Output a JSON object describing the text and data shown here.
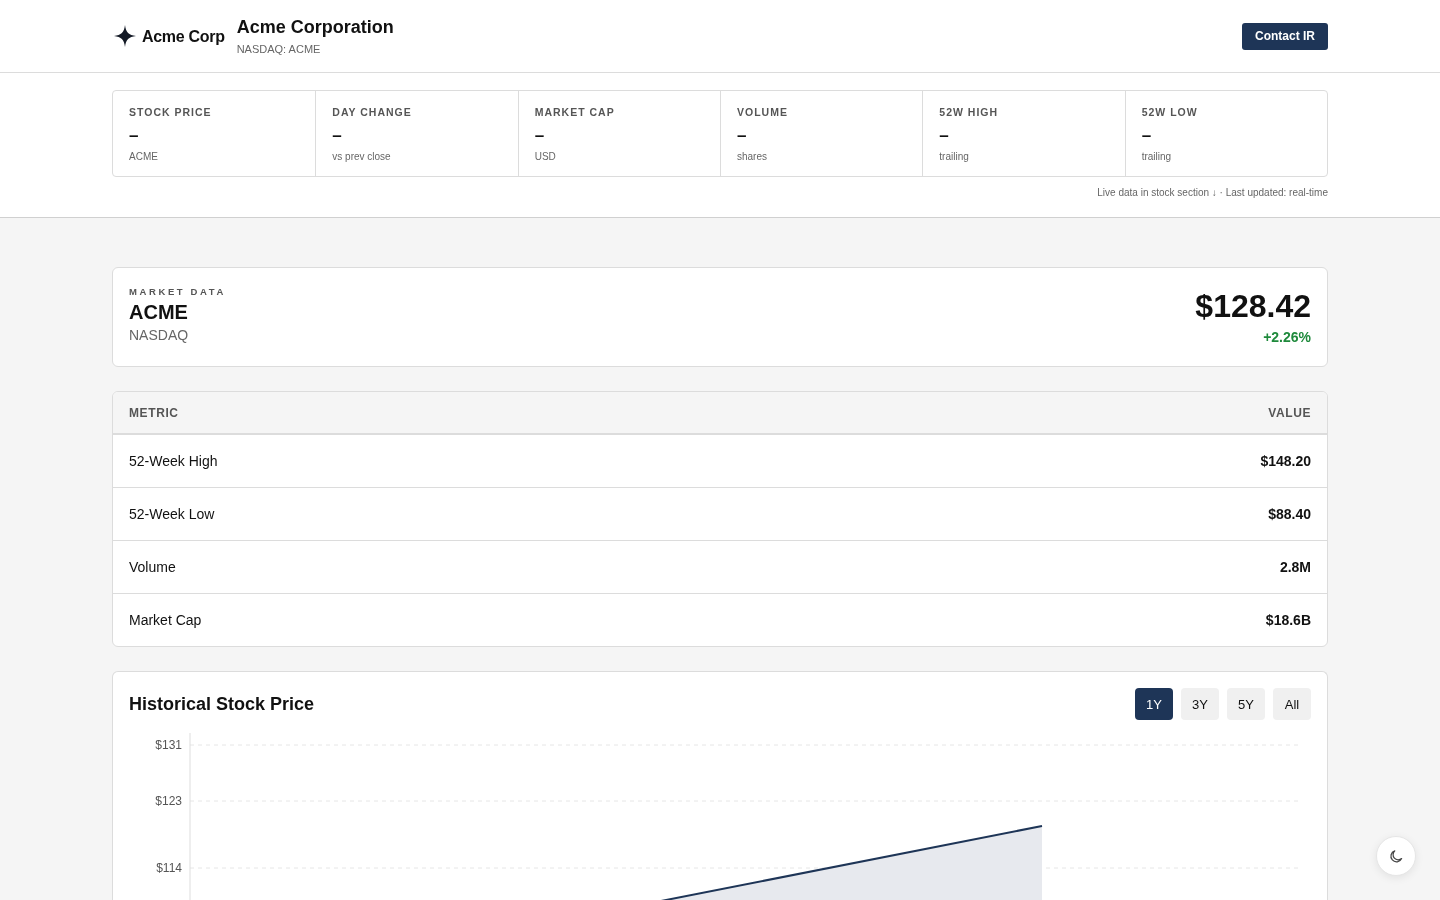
{
  "header": {
    "logo_text": "Acme Corp",
    "title": "Acme Corporation",
    "subtitle": "NASDAQ: ACME",
    "contact_button": "Contact IR"
  },
  "stats": [
    {
      "label": "STOCK PRICE",
      "value": "–",
      "caption": "ACME"
    },
    {
      "label": "DAY CHANGE",
      "value": "–",
      "caption": "vs prev close"
    },
    {
      "label": "MARKET CAP",
      "value": "–",
      "caption": "USD"
    },
    {
      "label": "VOLUME",
      "value": "–",
      "caption": "shares"
    },
    {
      "label": "52W HIGH",
      "value": "–",
      "caption": "trailing"
    },
    {
      "label": "52W LOW",
      "value": "–",
      "caption": "trailing"
    }
  ],
  "stats_note": "Live data in stock section ↓ · Last updated: real-time",
  "market": {
    "eyebrow": "MARKET DATA",
    "symbol": "ACME",
    "exchange": "NASDAQ",
    "price": "$128.42",
    "change": "+2.26%",
    "rising": true
  },
  "metrics_table": {
    "columns": [
      "METRIC",
      "VALUE"
    ],
    "rows": [
      {
        "metric": "52-Week High",
        "value": "$148.20"
      },
      {
        "metric": "52-Week Low",
        "value": "$88.40"
      },
      {
        "metric": "Volume",
        "value": "2.8M"
      },
      {
        "metric": "Market Cap",
        "value": "$18.6B"
      }
    ]
  },
  "chart": {
    "title": "Historical Stock Price",
    "ranges": [
      {
        "label": "1Y",
        "selected": true
      },
      {
        "label": "3Y",
        "selected": false
      },
      {
        "label": "5Y",
        "selected": false
      },
      {
        "label": "All",
        "selected": false
      }
    ],
    "y_tick_labels": [
      "$131",
      "$123",
      "$114"
    ]
  }
}
